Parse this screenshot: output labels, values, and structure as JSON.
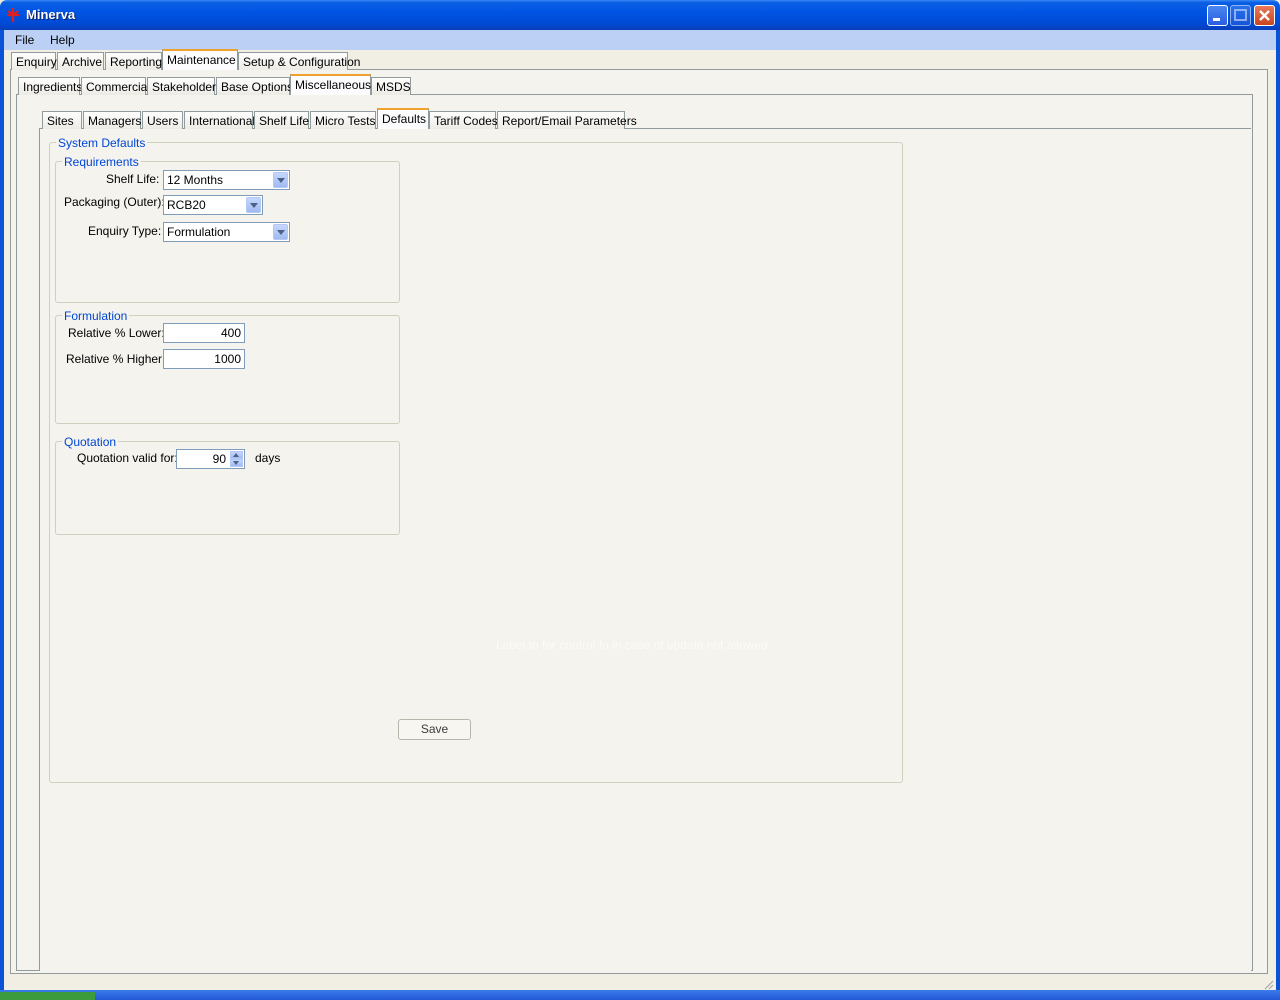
{
  "window": {
    "title": "Minerva"
  },
  "menu": {
    "items": [
      "File",
      "Help"
    ]
  },
  "top_tabs": [
    "Enquiry",
    "Archive",
    "Reporting",
    "Maintenance",
    "Setup & Configuration"
  ],
  "second_tabs": [
    "Ingredients",
    "Commercial",
    "Stakeholder",
    "Base Options",
    "Miscellaneous",
    "MSDS"
  ],
  "third_tabs": [
    "Sites",
    "Managers",
    "Users",
    "International",
    "Shelf Life",
    "Micro Tests",
    "Defaults",
    "Tariff Codes",
    "Report/Email Parameters"
  ],
  "system_defaults": {
    "title": "System Defaults",
    "requirements": {
      "title": "Requirements",
      "shelf_life_label": "Shelf Life:",
      "shelf_life_value": "12 Months",
      "packaging_label": "Packaging (Outer):",
      "packaging_value": "RCB20",
      "enquiry_type_label": "Enquiry Type:",
      "enquiry_type_value": "Formulation"
    },
    "formulation": {
      "title": "Formulation",
      "lower_label": "Relative % Lower:",
      "lower_value": "400",
      "higher_label": "Relative % Higher:",
      "higher_value": "1000"
    },
    "quotation": {
      "title": "Quotation",
      "valid_label": "Quotation valid for:",
      "valid_value": "90",
      "unit": "days"
    },
    "hidden_note": "Label to for control fo in case of update not allowed",
    "save_label": "Save"
  },
  "colors": {
    "titlebar": "#0054e3",
    "group_label": "#0046d5",
    "active_tab_accent": "#f0a22e"
  }
}
